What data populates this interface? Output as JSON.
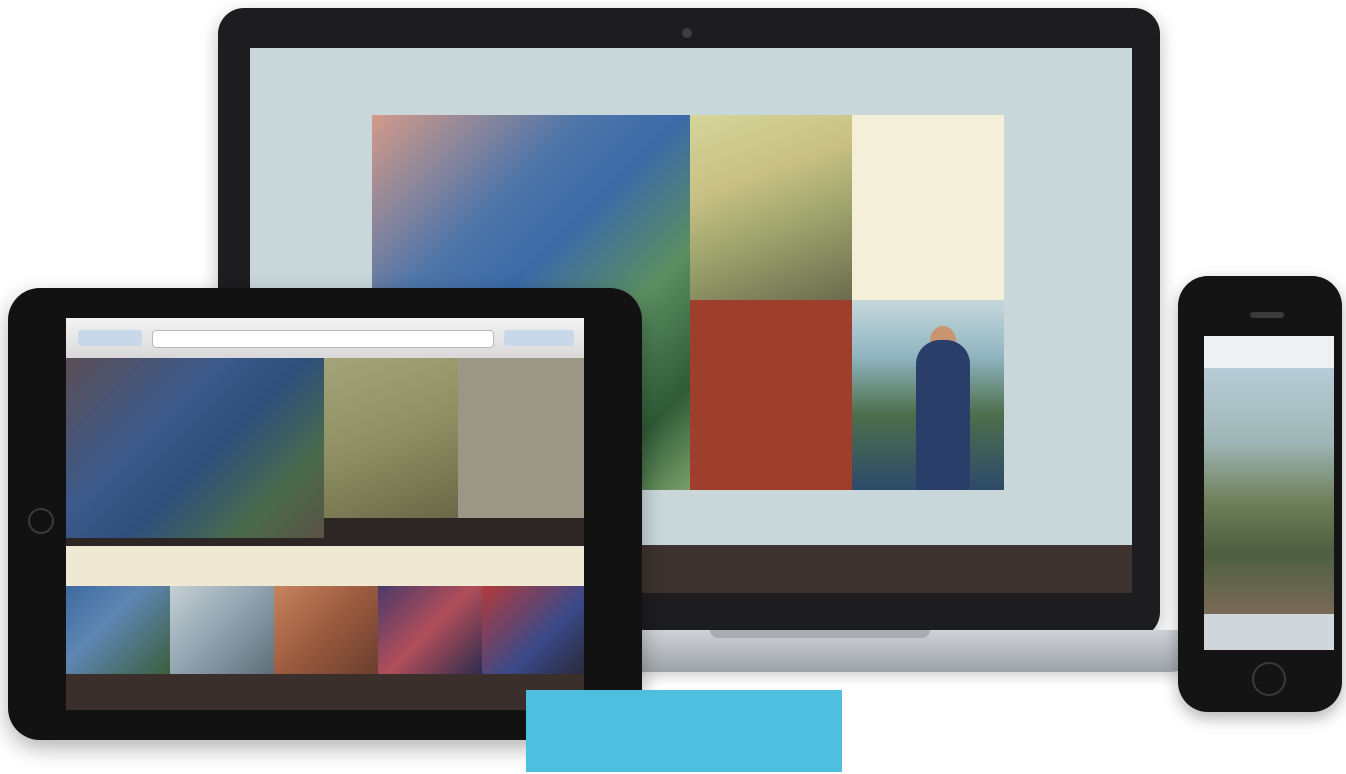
{
  "laptop": {
    "tiles": {
      "card_title": "",
      "card_subtitle": "",
      "red_title": "",
      "red_subtitle": ""
    },
    "footer": {
      "nav": [
        "",
        "",
        "",
        "",
        ""
      ]
    }
  },
  "tablet": {
    "browser": {
      "url": ""
    },
    "card_title": "",
    "strip": [
      "",
      "",
      "",
      "",
      ""
    ],
    "footer": {
      "nav": [
        "",
        "",
        "",
        "",
        ""
      ]
    }
  },
  "cta": {
    "label": ""
  },
  "colors": {
    "accent": "#4fbfe0",
    "tile_red": "#9e3e2c",
    "footer_brown": "#3d322e",
    "laptop_background": "#c9d7da"
  }
}
